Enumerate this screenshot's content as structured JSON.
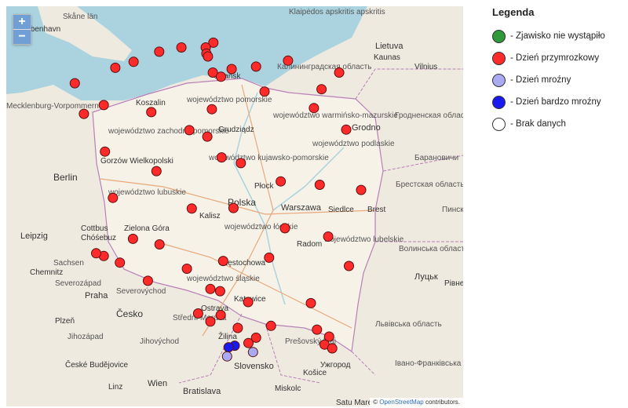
{
  "zoom": {
    "in_label": "+",
    "out_label": "−"
  },
  "attribution": {
    "prefix": "©",
    "link": "OpenStreetMap",
    "suffix": "contributors."
  },
  "legend": {
    "title": "Legenda",
    "items": [
      {
        "label": "- Zjawisko nie wystąpiło",
        "color": "#2e9a3a"
      },
      {
        "label": "- Dzień przymrozkowy",
        "color": "#ff2a2a"
      },
      {
        "label": "- Dzień mroźny",
        "color": "#aaaaf2"
      },
      {
        "label": "- Dzień bardzo mroźny",
        "color": "#1a1af0"
      },
      {
        "label": "- Brak danych",
        "color": "#ffffff"
      }
    ]
  },
  "map": {
    "labels": [
      "København",
      "Skåne län",
      "Klaipėdos apskritis",
      "apskritis",
      "Lietuva",
      "Kaunas",
      "Vilnius",
      "Калининградская область",
      "Gdańsk",
      "Koszalin",
      "Mecklenburg-Vorpommern",
      "województwo pomorskie",
      "województwo zachodniopomorskie",
      "Grudziądz",
      "województwo warmińsko-mazurskie",
      "Grodno",
      "Гродненская область",
      "Барановичи",
      "Gorzów Wielkopolski",
      "województwo kujawsko-pomorskie",
      "województwo podlaskie",
      "Berlin",
      "województwo lubuskie",
      "Płock",
      "Warszawa",
      "Брестская область",
      "Brest",
      "Пинск",
      "Kalisz",
      "Polska",
      "Siedlce",
      "Cottbus",
      "Chóśebuz",
      "Zielona Góra",
      "województwo łódzkie",
      "Radom",
      "Leipzig",
      "Sachsen",
      "Chemnitz",
      "województwo lubelskie",
      "Волинська область",
      "Луцьк",
      "Рівне",
      "Częstochowa",
      "Severozápad",
      "Praha",
      "Severovýchod",
      "województwo śląskie",
      "Česko",
      "Plzeň",
      "Katowice",
      "Ostrava",
      "Střední Morava",
      "Jihovýchod",
      "Jihozápad",
      "Žilina",
      "Prešovský kraj",
      "Ужгород",
      "Львівська область",
      "Івано-Франківська область",
      "Slovensko",
      "Košice",
      "České Budějovice",
      "Linz",
      "Wien",
      "Bratislava",
      "Miskolc",
      "Satu Mare"
    ],
    "stations": [
      {
        "lat": 54.6,
        "lon": 18.8,
        "status": "frost"
      },
      {
        "lat": 54.52,
        "lon": 18.55,
        "status": "frost"
      },
      {
        "lat": 54.42,
        "lon": 18.57,
        "status": "frost"
      },
      {
        "lat": 54.37,
        "lon": 18.62,
        "status": "frost"
      },
      {
        "lat": 54.45,
        "lon": 17.02,
        "status": "frost"
      },
      {
        "lat": 54.28,
        "lon": 16.18,
        "status": "frost"
      },
      {
        "lat": 54.18,
        "lon": 15.58,
        "status": "frost"
      },
      {
        "lat": 54.52,
        "lon": 17.75,
        "status": "frost"
      },
      {
        "lat": 54.1,
        "lon": 18.78,
        "status": "frost"
      },
      {
        "lat": 54.03,
        "lon": 19.05,
        "status": "frost"
      },
      {
        "lat": 54.16,
        "lon": 19.4,
        "status": "frost"
      },
      {
        "lat": 54.2,
        "lon": 20.2,
        "status": "frost"
      },
      {
        "lat": 54.3,
        "lon": 21.25,
        "status": "frost"
      },
      {
        "lat": 54.1,
        "lon": 22.93,
        "status": "frost"
      },
      {
        "lat": 53.78,
        "lon": 20.48,
        "status": "frost"
      },
      {
        "lat": 53.82,
        "lon": 22.35,
        "status": "frost"
      },
      {
        "lat": 53.13,
        "lon": 23.16,
        "status": "frost"
      },
      {
        "lat": 53.5,
        "lon": 22.1,
        "status": "frost"
      },
      {
        "lat": 53.4,
        "lon": 14.55,
        "status": "frost"
      },
      {
        "lat": 53.55,
        "lon": 15.2,
        "status": "frost"
      },
      {
        "lat": 53.92,
        "lon": 14.25,
        "status": "frost"
      },
      {
        "lat": 53.43,
        "lon": 16.76,
        "status": "frost"
      },
      {
        "lat": 53.48,
        "lon": 18.75,
        "status": "frost"
      },
      {
        "lat": 53.12,
        "lon": 18.01,
        "status": "frost"
      },
      {
        "lat": 53.01,
        "lon": 18.6,
        "status": "frost"
      },
      {
        "lat": 52.75,
        "lon": 15.24,
        "status": "frost"
      },
      {
        "lat": 52.65,
        "lon": 19.07,
        "status": "frost"
      },
      {
        "lat": 52.55,
        "lon": 19.7,
        "status": "frost"
      },
      {
        "lat": 52.41,
        "lon": 16.93,
        "status": "frost"
      },
      {
        "lat": 52.23,
        "lon": 21.01,
        "status": "frost"
      },
      {
        "lat": 52.17,
        "lon": 22.29,
        "status": "frost"
      },
      {
        "lat": 52.08,
        "lon": 23.65,
        "status": "frost"
      },
      {
        "lat": 51.94,
        "lon": 15.5,
        "status": "frost"
      },
      {
        "lat": 51.76,
        "lon": 19.46,
        "status": "frost"
      },
      {
        "lat": 51.4,
        "lon": 21.15,
        "status": "frost"
      },
      {
        "lat": 51.25,
        "lon": 22.57,
        "status": "frost"
      },
      {
        "lat": 51.75,
        "lon": 18.09,
        "status": "frost"
      },
      {
        "lat": 51.11,
        "lon": 17.03,
        "status": "frost"
      },
      {
        "lat": 51.21,
        "lon": 16.16,
        "status": "frost"
      },
      {
        "lat": 50.81,
        "lon": 19.12,
        "status": "frost"
      },
      {
        "lat": 50.87,
        "lon": 20.63,
        "status": "frost"
      },
      {
        "lat": 50.72,
        "lon": 23.25,
        "status": "frost"
      },
      {
        "lat": 50.67,
        "lon": 17.93,
        "status": "frost"
      },
      {
        "lat": 50.26,
        "lon": 19.02,
        "status": "frost"
      },
      {
        "lat": 50.06,
        "lon": 19.94,
        "status": "frost"
      },
      {
        "lat": 50.04,
        "lon": 22.0,
        "status": "frost"
      },
      {
        "lat": 49.82,
        "lon": 19.04,
        "status": "frost"
      },
      {
        "lat": 49.62,
        "lon": 20.69,
        "status": "frost"
      },
      {
        "lat": 49.3,
        "lon": 19.95,
        "status": "frost"
      },
      {
        "lat": 49.55,
        "lon": 22.2,
        "status": "frost"
      },
      {
        "lat": 49.42,
        "lon": 22.6,
        "status": "frost"
      },
      {
        "lat": 49.27,
        "lon": 22.45,
        "status": "frost"
      },
      {
        "lat": 49.2,
        "lon": 22.7,
        "status": "frost"
      },
      {
        "lat": 50.3,
        "lon": 18.7,
        "status": "frost"
      },
      {
        "lat": 50.45,
        "lon": 16.65,
        "status": "frost"
      },
      {
        "lat": 50.78,
        "lon": 15.73,
        "status": "frost"
      },
      {
        "lat": 50.9,
        "lon": 15.2,
        "status": "frost"
      },
      {
        "lat": 50.95,
        "lon": 14.95,
        "status": "frost"
      },
      {
        "lat": 49.85,
        "lon": 18.3,
        "status": "frost"
      },
      {
        "lat": 49.7,
        "lon": 18.7,
        "status": "frost"
      },
      {
        "lat": 49.58,
        "lon": 19.6,
        "status": "frost"
      },
      {
        "lat": 49.4,
        "lon": 20.2,
        "status": "frost"
      },
      {
        "lat": 49.25,
        "lon": 19.5,
        "status": "severe"
      },
      {
        "lat": 49.22,
        "lon": 19.3,
        "status": "severe"
      },
      {
        "lat": 49.05,
        "lon": 19.25,
        "status": "freeze"
      },
      {
        "lat": 49.13,
        "lon": 20.1,
        "status": "freeze"
      }
    ]
  }
}
